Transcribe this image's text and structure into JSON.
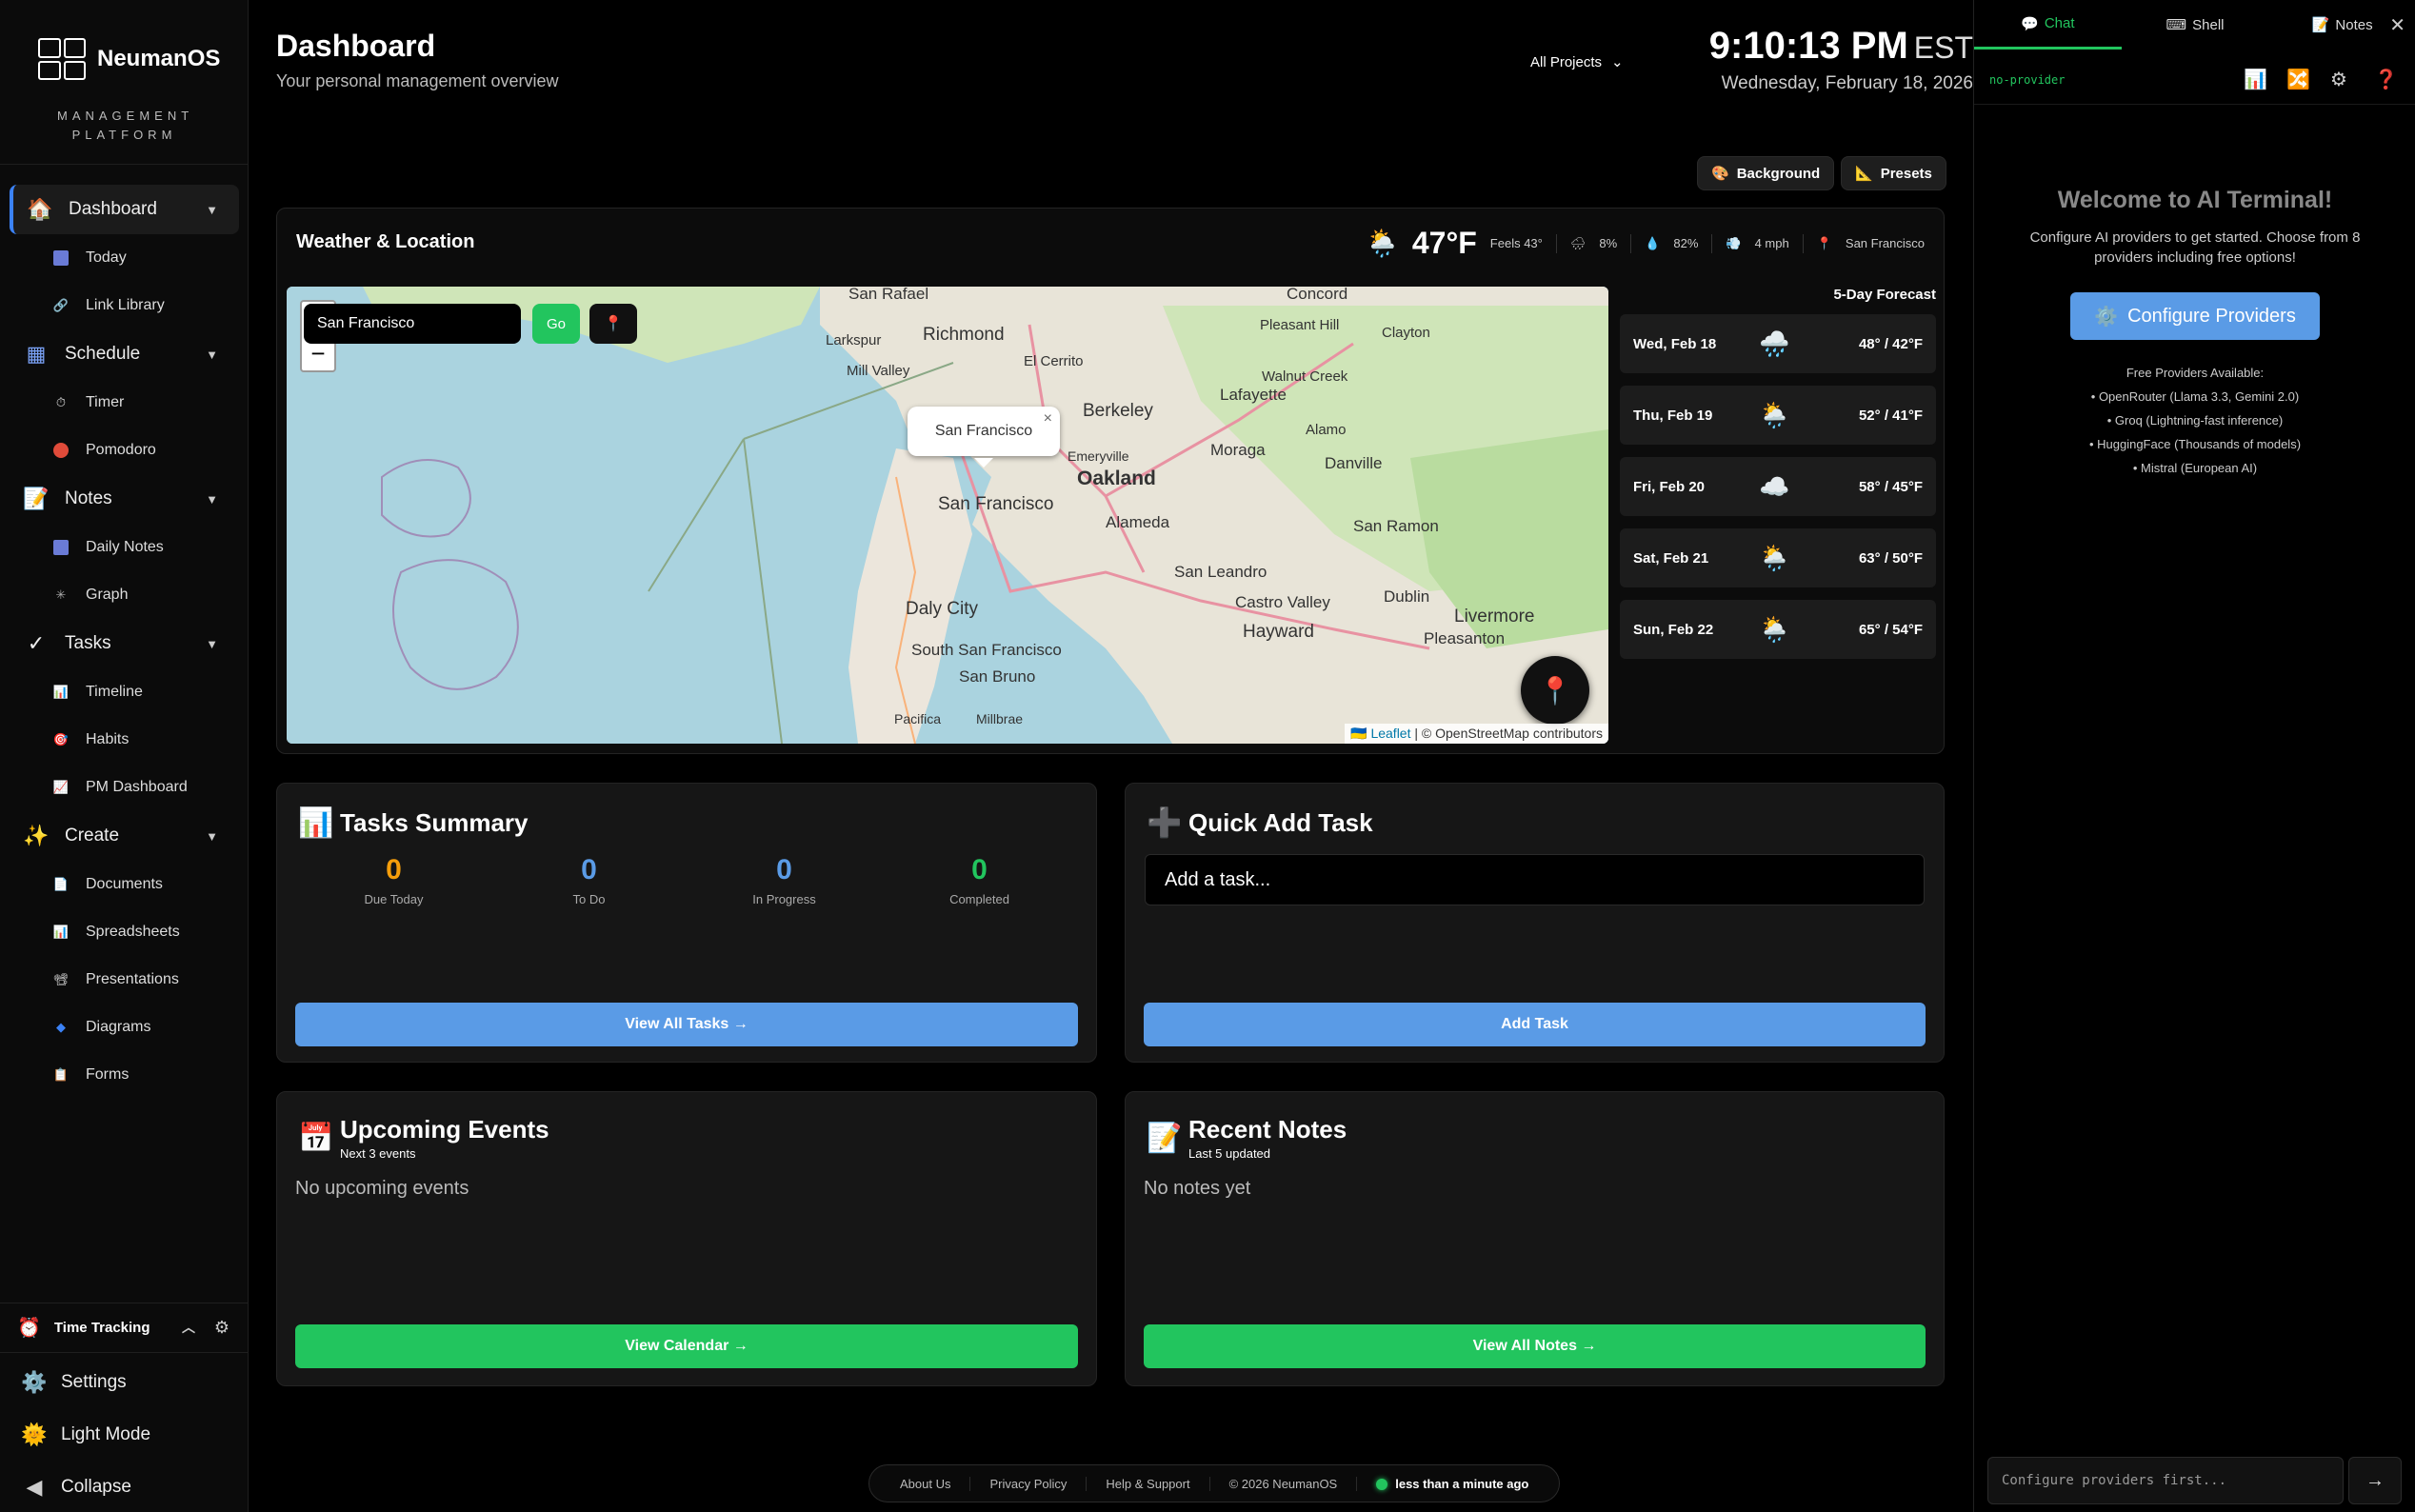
{
  "sidebar": {
    "logo_name": "NeumanOS",
    "logo_sub": "MANAGEMENT PLATFORM",
    "groups": [
      {
        "label": "Dashboard",
        "icon": "home-icon",
        "items": [
          {
            "label": "Today",
            "icon": "calendar-icon"
          },
          {
            "label": "Link Library",
            "icon": "link-icon"
          }
        ]
      },
      {
        "label": "Schedule",
        "icon": "calendar-grid-icon",
        "items": [
          {
            "label": "Timer",
            "icon": "stopwatch-icon"
          },
          {
            "label": "Pomodoro",
            "icon": "tomato-icon"
          }
        ]
      },
      {
        "label": "Notes",
        "icon": "memo-icon",
        "items": [
          {
            "label": "Daily Notes",
            "icon": "calendar-icon"
          },
          {
            "label": "Graph",
            "icon": "graph-icon"
          }
        ]
      },
      {
        "label": "Tasks",
        "icon": "checkmark-icon",
        "items": [
          {
            "label": "Timeline",
            "icon": "bar-chart-icon"
          },
          {
            "label": "Habits",
            "icon": "target-icon"
          },
          {
            "label": "PM Dashboard",
            "icon": "line-chart-icon"
          }
        ]
      },
      {
        "label": "Create",
        "icon": "sparkles-icon",
        "items": [
          {
            "label": "Documents",
            "icon": "document-icon"
          },
          {
            "label": "Spreadsheets",
            "icon": "bar-chart-icon"
          },
          {
            "label": "Presentations",
            "icon": "projector-icon"
          },
          {
            "label": "Diagrams",
            "icon": "diamond-icon"
          },
          {
            "label": "Forms",
            "icon": "clipboard-icon"
          }
        ]
      }
    ],
    "time_tracking": "Time Tracking",
    "settings": "Settings",
    "light_mode": "Light Mode",
    "collapse": "Collapse"
  },
  "header": {
    "title": "Dashboard",
    "subtitle": "Your personal management overview",
    "project_select": "All Projects",
    "time": "9:10:13 PM",
    "tz": "EST",
    "date": "Wednesday, February 18, 2026",
    "background_btn": "Background",
    "presets_btn": "Presets"
  },
  "weather": {
    "title": "Weather & Location",
    "temp": "47°F",
    "feels": "Feels 43°",
    "precip": "8%",
    "humidity": "82%",
    "wind": "4 mph",
    "location": "San Francisco",
    "search_value": "San Francisco",
    "go_label": "Go",
    "popup": "San Francisco",
    "attribution_link": "Leaflet",
    "attribution_text": "| © OpenStreetMap contributors",
    "map_labels": [
      "San Rafael",
      "Richmond",
      "Berkeley",
      "Concord",
      "Oakland",
      "Alameda",
      "San Francisco",
      "Daly City",
      "South San Francisco",
      "San Bruno",
      "Hayward",
      "Livermore",
      "San Leandro",
      "Castro Valley",
      "Dublin",
      "Pleasanton",
      "Danville",
      "Moraga",
      "Lafayette",
      "San Ramon",
      "El Cerrito",
      "Mill Valley",
      "Emeryville",
      "Walnut Creek",
      "Clayton",
      "Pacifica",
      "Millbrae",
      "Alamo",
      "Larkspur",
      "Pleasant Hill"
    ],
    "forecast_title": "5-Day Forecast",
    "forecast": [
      {
        "day": "Wed, Feb 18",
        "icon": "rain-cloud-icon",
        "temps": "48° / 42°F"
      },
      {
        "day": "Thu, Feb 19",
        "icon": "sun-rain-cloud-icon",
        "temps": "52° / 41°F"
      },
      {
        "day": "Fri, Feb 20",
        "icon": "cloud-icon",
        "temps": "58° / 45°F"
      },
      {
        "day": "Sat, Feb 21",
        "icon": "sun-rain-cloud-icon",
        "temps": "63° / 50°F"
      },
      {
        "day": "Sun, Feb 22",
        "icon": "sun-rain-cloud-icon",
        "temps": "65° / 54°F"
      }
    ]
  },
  "tasks_summary": {
    "title": "Tasks Summary",
    "stats": [
      {
        "value": "0",
        "label": "Due Today",
        "color": "#f59e0b"
      },
      {
        "value": "0",
        "label": "To Do",
        "color": "#5a9be6"
      },
      {
        "value": "0",
        "label": "In Progress",
        "color": "#5a9be6"
      },
      {
        "value": "0",
        "label": "Completed",
        "color": "#22c55e"
      }
    ],
    "button": "View All Tasks →"
  },
  "quick_add": {
    "title": "Quick Add Task",
    "placeholder": "Add a task...",
    "button": "Add Task"
  },
  "events": {
    "title": "Upcoming Events",
    "subtitle": "Next 3 events",
    "empty": "No upcoming events",
    "button": "View Calendar →"
  },
  "notes": {
    "title": "Recent Notes",
    "subtitle": "Last 5 updated",
    "empty": "No notes yet",
    "button": "View All Notes →"
  },
  "footer": {
    "links": [
      "About Us",
      "Privacy Policy",
      "Help & Support",
      "© 2026 NeumanOS"
    ],
    "status": "less than a minute ago"
  },
  "right_panel": {
    "tabs": [
      "Chat",
      "Shell",
      "Notes"
    ],
    "provider": "no-provider",
    "welcome_title": "Welcome to AI Terminal!",
    "welcome_text": "Configure AI providers to get started. Choose from 8 providers including free options!",
    "configure_btn": "Configure Providers",
    "free_title": "Free Providers Available:",
    "free_list": [
      "• OpenRouter (Llama 3.3, Gemini 2.0)",
      "• Groq (Lightning-fast inference)",
      "• HuggingFace (Thousands of models)",
      "• Mistral (European AI)"
    ],
    "input_placeholder": "Configure providers first...",
    "send": "→"
  }
}
